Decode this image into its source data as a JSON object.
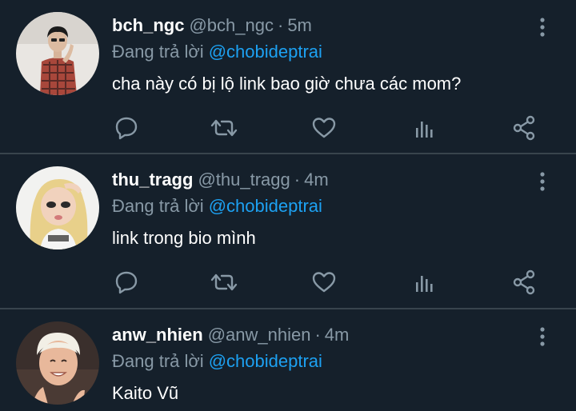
{
  "replying_label": "Đang trả lời",
  "tweets": [
    {
      "display_name": "bch_ngc",
      "handle": "@bch_ngc",
      "separator": "·",
      "time": "5m",
      "reply_to": "@chobideptrai",
      "text": "cha này có bị lộ link bao giờ chưa các mom?"
    },
    {
      "display_name": "thu_tragg",
      "handle": "@thu_tragg",
      "separator": "·",
      "time": "4m",
      "reply_to": "@chobideptrai",
      "text": "link trong bio mình"
    },
    {
      "display_name": "anw_nhien",
      "handle": "@anw_nhien",
      "separator": "·",
      "time": "4m",
      "reply_to": "@chobideptrai",
      "text": "Kaito Vũ"
    }
  ],
  "icons": {
    "more": "more-vertical-icon",
    "reply": "comment-bubble-icon",
    "retweet": "retweet-icon",
    "like": "heart-icon",
    "views": "bar-chart-icon",
    "share": "share-icon"
  },
  "colors": {
    "background": "#15202b",
    "divider": "#38444d",
    "muted_text": "#8899a6",
    "mention": "#1da1f2",
    "primary_text": "#ffffff"
  }
}
